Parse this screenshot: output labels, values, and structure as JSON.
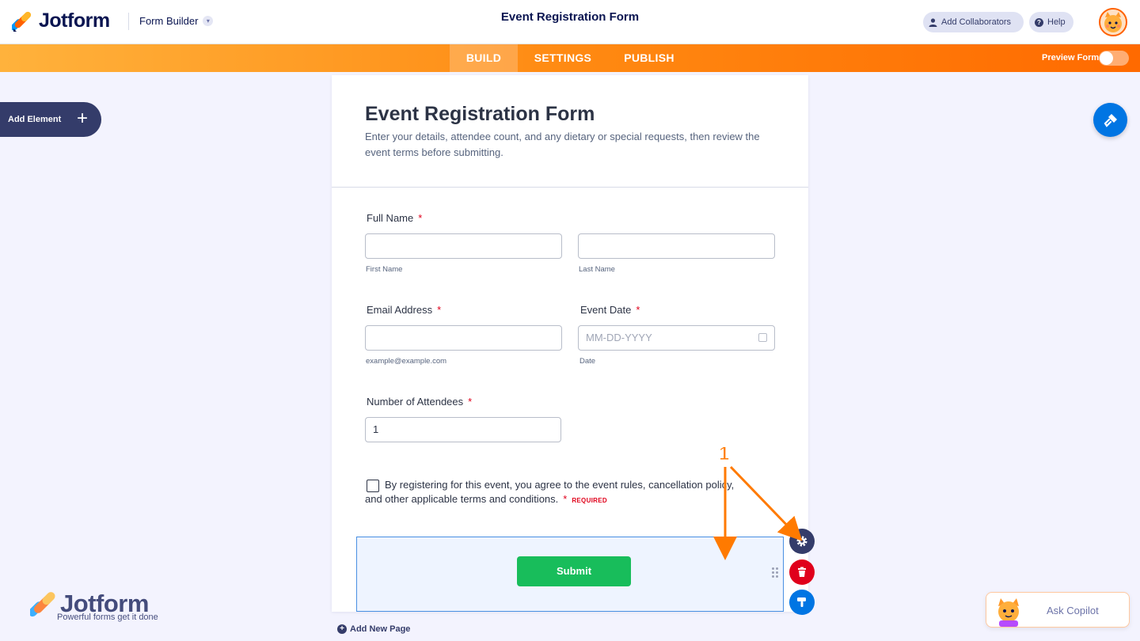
{
  "app": {
    "brand": "Jotform",
    "builder_menu": "Form Builder",
    "title": "Event Registration Form",
    "add_collaborators": "Add Collaborators",
    "help": "Help"
  },
  "nav": {
    "tabs": [
      "BUILD",
      "SETTINGS",
      "PUBLISH"
    ],
    "active_tab": "BUILD",
    "preview_label": "Preview Form",
    "preview_enabled": false
  },
  "left_panel": {
    "add_element": "Add Element"
  },
  "form": {
    "title": "Event Registration Form",
    "description": "Enter your details, attendee count, and any dietary or special requests, then review the event terms before submitting.",
    "fields": {
      "full_name": {
        "label": "Full Name",
        "required_mark": "*",
        "first_sub": "First Name",
        "last_sub": "Last Name",
        "first_value": "",
        "last_value": ""
      },
      "email": {
        "label": "Email Address",
        "required_mark": "*",
        "sub": "example@example.com",
        "value": ""
      },
      "event_date": {
        "label": "Event Date",
        "required_mark": "*",
        "placeholder": "MM-DD-YYYY",
        "sub": "Date"
      },
      "attendees": {
        "label": "Number of Attendees",
        "required_mark": "*",
        "value": "1"
      },
      "terms": {
        "text": "By registering for this event, you agree to the event rules, cancellation policy, and other applicable terms and conditions.",
        "required_mark": "*",
        "required_tag": "REQUIRED",
        "checked": false
      }
    },
    "submit_label": "Submit"
  },
  "footer": {
    "add_new_page": "Add New Page",
    "brand": "Jotform",
    "tagline": "Powerful forms get it done",
    "copilot": "Ask Copilot"
  },
  "annotation": {
    "number": "1",
    "color": "#ff7a00"
  },
  "colors": {
    "accent_orange": "#ff6100",
    "submit_green": "#18bd5b",
    "navy": "#0a1551",
    "danger": "#e0001b",
    "blue": "#0075e3"
  }
}
